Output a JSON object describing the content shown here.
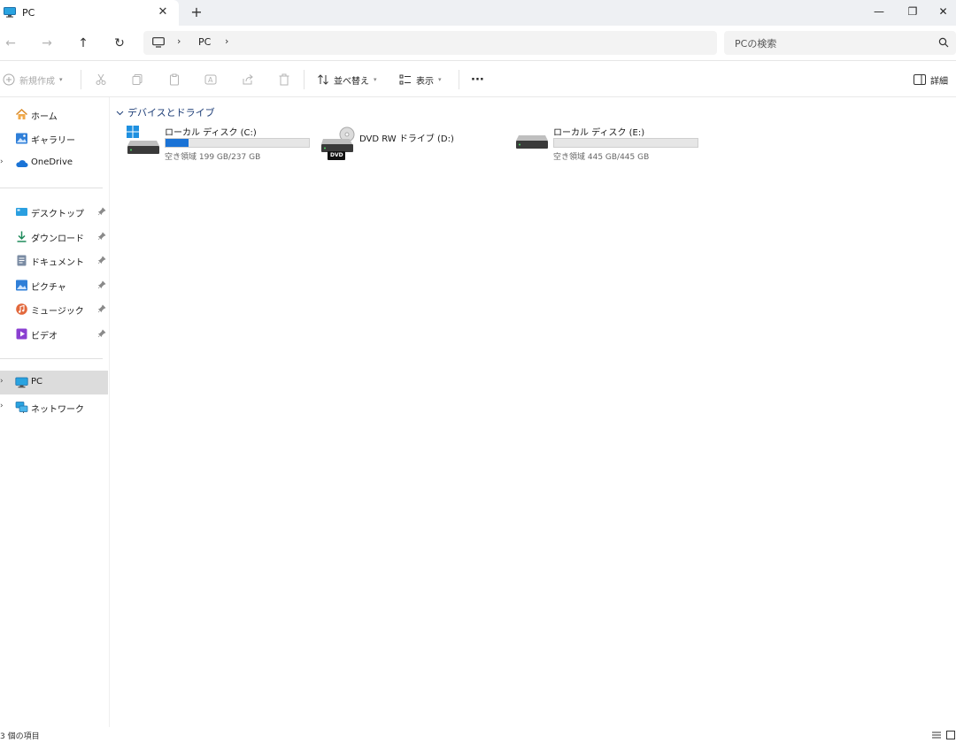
{
  "window": {
    "tab_title": "PC",
    "tab_close": "✕",
    "new_tab": "+",
    "minimize": "—",
    "restore": "❐",
    "close": "✕"
  },
  "address_bar": {
    "back": "←",
    "forward": "→",
    "up": "↑",
    "refresh": "↻",
    "chevron": "›",
    "breadcrumb": "PC",
    "search_placeholder": "PCの検索"
  },
  "toolbar": {
    "new": "新規作成",
    "sort": "並べ替え",
    "view": "表示",
    "more": "···",
    "details": "詳細"
  },
  "sidebar": {
    "top": [
      {
        "label": "ホーム",
        "icon": "home-icon"
      },
      {
        "label": "ギャラリー",
        "icon": "gallery-icon"
      },
      {
        "label": "OneDrive",
        "icon": "cloud-icon"
      }
    ],
    "quick": [
      {
        "label": "デスクトップ",
        "icon": "desktop-icon"
      },
      {
        "label": "ダウンロード",
        "icon": "download-icon"
      },
      {
        "label": "ドキュメント",
        "icon": "document-icon"
      },
      {
        "label": "ピクチャ",
        "icon": "picture-icon"
      },
      {
        "label": "ミュージック",
        "icon": "music-icon"
      },
      {
        "label": "ビデオ",
        "icon": "video-icon"
      }
    ],
    "devices": [
      {
        "label": "PC",
        "icon": "pc-icon",
        "selected": true
      },
      {
        "label": "ネットワーク",
        "icon": "network-icon"
      }
    ],
    "expander": "›"
  },
  "content": {
    "group_title": "デバイスとドライブ",
    "drives": [
      {
        "name": "ローカル ディスク (C:)",
        "free": "空き領域 199 GB/237 GB",
        "used_fraction": 0.16,
        "icon": "windows-drive-icon"
      },
      {
        "name": "DVD RW ドライブ (D:)",
        "free": "",
        "icon": "dvd-drive-icon",
        "badge": "DVD"
      },
      {
        "name": "ローカル ディスク (E:)",
        "free": "空き領域 445 GB/445 GB",
        "used_fraction": 0.0,
        "icon": "hard-drive-icon"
      }
    ]
  },
  "status": {
    "item_count": "3 個の項目"
  },
  "colors": {
    "accent": "#1a73d6",
    "selected_bg": "#dcdcdc",
    "group_header": "#1f3f78"
  }
}
